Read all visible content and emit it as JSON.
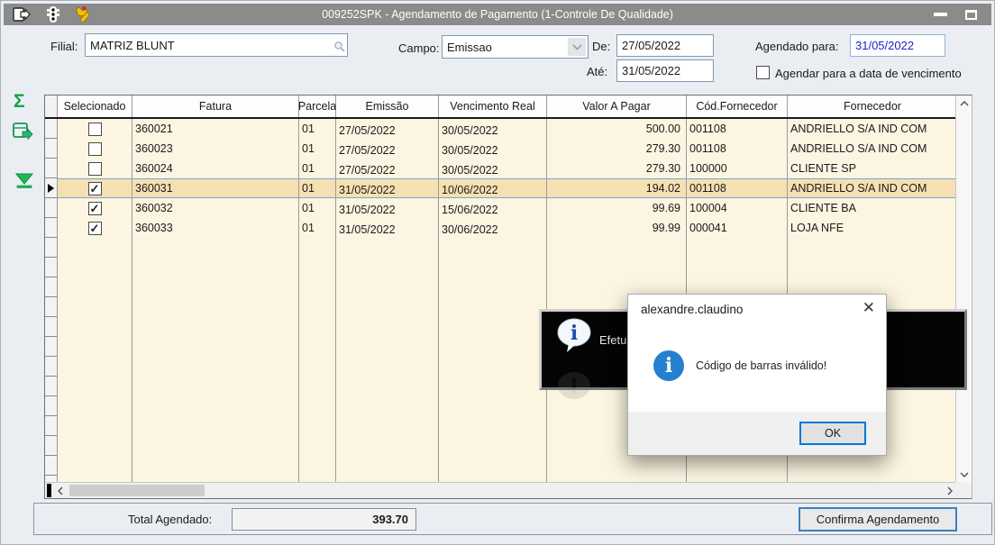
{
  "window": {
    "title": "009252SPK - Agendamento de Pagamento (1-Controle De Qualidade)"
  },
  "toolbar_icons": [
    "exit-icon",
    "traffic-light-icon",
    "wrench-icon"
  ],
  "sidebar_icons": {
    "sum": "Σ",
    "export": "export-grid-icon",
    "filter": "funnel-icon"
  },
  "filters": {
    "filial_label": "Filial:",
    "filial_value": "MATRIZ BLUNT",
    "campo_label": "Campo:",
    "campo_value": "Emissao",
    "de_label": "De:",
    "de_value": "27/05/2022",
    "ate_label": "Até:",
    "ate_value": "31/05/2022",
    "agendado_label": "Agendado para:",
    "agendado_value": "31/05/2022",
    "vencimento_checkbox_label": "Agendar para a data de vencimento",
    "vencimento_checkbox_checked": false
  },
  "grid": {
    "columns": [
      "Selecionado",
      "Fatura",
      "Parcela",
      "Emissão",
      "Vencimento Real",
      "Valor A Pagar",
      "Cód.Fornecedor",
      "Fornecedor"
    ],
    "rows": [
      {
        "selected": false,
        "current": false,
        "fatura": "360021",
        "parcela": "01",
        "emissao": "27/05/2022",
        "vencimento": "30/05/2022",
        "valor": "500.00",
        "cod": "001108",
        "fornecedor": "ANDRIELLO S/A IND COM"
      },
      {
        "selected": false,
        "current": false,
        "fatura": "360023",
        "parcela": "01",
        "emissao": "27/05/2022",
        "vencimento": "30/05/2022",
        "valor": "279.30",
        "cod": "001108",
        "fornecedor": "ANDRIELLO S/A IND COM"
      },
      {
        "selected": false,
        "current": false,
        "fatura": "360024",
        "parcela": "01",
        "emissao": "27/05/2022",
        "vencimento": "30/05/2022",
        "valor": "279.30",
        "cod": "100000",
        "fornecedor": "CLIENTE SP"
      },
      {
        "selected": true,
        "current": true,
        "fatura": "360031",
        "parcela": "01",
        "emissao": "31/05/2022",
        "vencimento": "10/06/2022",
        "valor": "194.02",
        "cod": "001108",
        "fornecedor": "ANDRIELLO S/A IND COM"
      },
      {
        "selected": true,
        "current": false,
        "fatura": "360032",
        "parcela": "01",
        "emissao": "31/05/2022",
        "vencimento": "15/06/2022",
        "valor": "99.69",
        "cod": "100004",
        "fornecedor": "CLIENTE BA"
      },
      {
        "selected": true,
        "current": false,
        "fatura": "360033",
        "parcela": "01",
        "emissao": "31/05/2022",
        "vencimento": "30/06/2022",
        "valor": "99.99",
        "cod": "000041",
        "fornecedor": "LOJA NFE"
      }
    ]
  },
  "footer": {
    "total_label": "Total Agendado:",
    "total_value": "393.70",
    "confirm_button": "Confirma Agendamento"
  },
  "toast": {
    "visible_text": "Efetu"
  },
  "dialog": {
    "title": "alexandre.claudino",
    "close_glyph": "✕",
    "info_glyph": "i",
    "message": "Código de barras inválido!",
    "ok_label": "OK"
  },
  "colors": {
    "titlebar": "#8B8B8B",
    "row_cream": "#FCF5E2",
    "row_selected": "#F6E0B2",
    "selection_border": "#6FA8D6",
    "focus_blue": "#0078D7",
    "dialog_info_blue": "#2480D0",
    "scheduled_date_text": "#2222CC",
    "sidebar_icon_green": "#16A24A"
  }
}
